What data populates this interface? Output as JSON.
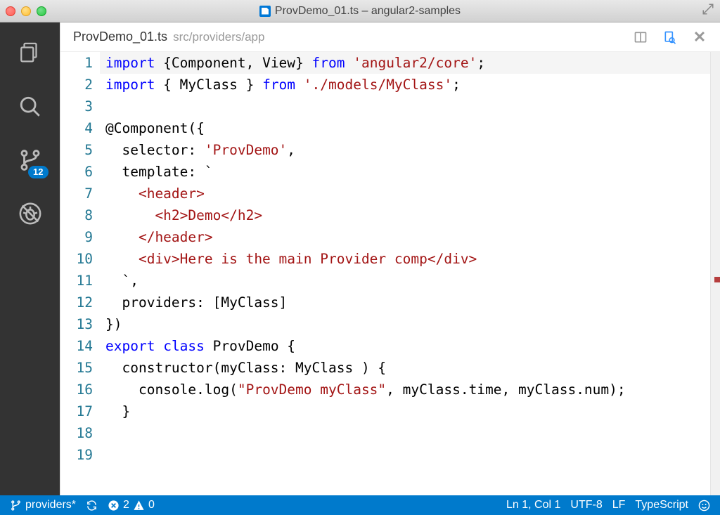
{
  "window": {
    "title": "ProvDemo_01.ts – angular2-samples"
  },
  "activity_bar": {
    "git_badge": "12"
  },
  "tab": {
    "filename": "ProvDemo_01.ts",
    "subpath": "src/providers/app"
  },
  "code": {
    "lines": [
      {
        "n": "1",
        "segs": [
          {
            "c": "kw",
            "t": "import"
          },
          {
            "c": "d",
            "t": " {Component, View} "
          },
          {
            "c": "kw",
            "t": "from"
          },
          {
            "c": "d",
            "t": " "
          },
          {
            "c": "str",
            "t": "'angular2/core'"
          },
          {
            "c": "d",
            "t": ";"
          }
        ]
      },
      {
        "n": "2",
        "segs": [
          {
            "c": "kw",
            "t": "import"
          },
          {
            "c": "d",
            "t": " { MyClass } "
          },
          {
            "c": "kw",
            "t": "from"
          },
          {
            "c": "d",
            "t": " "
          },
          {
            "c": "str",
            "t": "'./models/MyClass'"
          },
          {
            "c": "d",
            "t": ";"
          }
        ]
      },
      {
        "n": "3",
        "segs": [
          {
            "c": "d",
            "t": ""
          }
        ]
      },
      {
        "n": "4",
        "segs": [
          {
            "c": "d",
            "t": "@Component({"
          }
        ]
      },
      {
        "n": "5",
        "segs": [
          {
            "c": "d",
            "t": "  selector: "
          },
          {
            "c": "str",
            "t": "'ProvDemo'"
          },
          {
            "c": "d",
            "t": ","
          }
        ]
      },
      {
        "n": "6",
        "segs": [
          {
            "c": "d",
            "t": "  template: `"
          }
        ]
      },
      {
        "n": "7",
        "segs": [
          {
            "c": "str",
            "t": "    <header>"
          }
        ]
      },
      {
        "n": "8",
        "segs": [
          {
            "c": "str",
            "t": "      <h2>Demo</h2>"
          }
        ]
      },
      {
        "n": "9",
        "segs": [
          {
            "c": "str",
            "t": "    </header>"
          }
        ]
      },
      {
        "n": "10",
        "segs": [
          {
            "c": "str",
            "t": "    <div>Here is the main Provider comp</div>"
          }
        ]
      },
      {
        "n": "11",
        "segs": [
          {
            "c": "d",
            "t": "  `,"
          }
        ]
      },
      {
        "n": "12",
        "segs": [
          {
            "c": "d",
            "t": "  providers: [MyClass]"
          }
        ]
      },
      {
        "n": "13",
        "segs": [
          {
            "c": "d",
            "t": "})"
          }
        ]
      },
      {
        "n": "14",
        "segs": [
          {
            "c": "kw",
            "t": "export"
          },
          {
            "c": "d",
            "t": " "
          },
          {
            "c": "kw",
            "t": "class"
          },
          {
            "c": "d",
            "t": " ProvDemo {"
          }
        ]
      },
      {
        "n": "15",
        "segs": [
          {
            "c": "d",
            "t": "  constructor(myClass: MyClass ) {"
          }
        ]
      },
      {
        "n": "16",
        "segs": [
          {
            "c": "d",
            "t": "    console.log("
          },
          {
            "c": "str",
            "t": "\"ProvDemo myClass\""
          },
          {
            "c": "d",
            "t": ", myClass.time, myClass.num);"
          }
        ]
      },
      {
        "n": "17",
        "segs": [
          {
            "c": "d",
            "t": "  }"
          }
        ]
      },
      {
        "n": "18",
        "segs": [
          {
            "c": "d",
            "t": ""
          }
        ]
      },
      {
        "n": "19",
        "segs": [
          {
            "c": "d",
            "t": ""
          }
        ]
      }
    ]
  },
  "status_bar": {
    "branch": "providers*",
    "errors": "2",
    "warnings": "0",
    "cursor": "Ln 1, Col 1",
    "encoding": "UTF-8",
    "eol": "LF",
    "language": "TypeScript"
  }
}
